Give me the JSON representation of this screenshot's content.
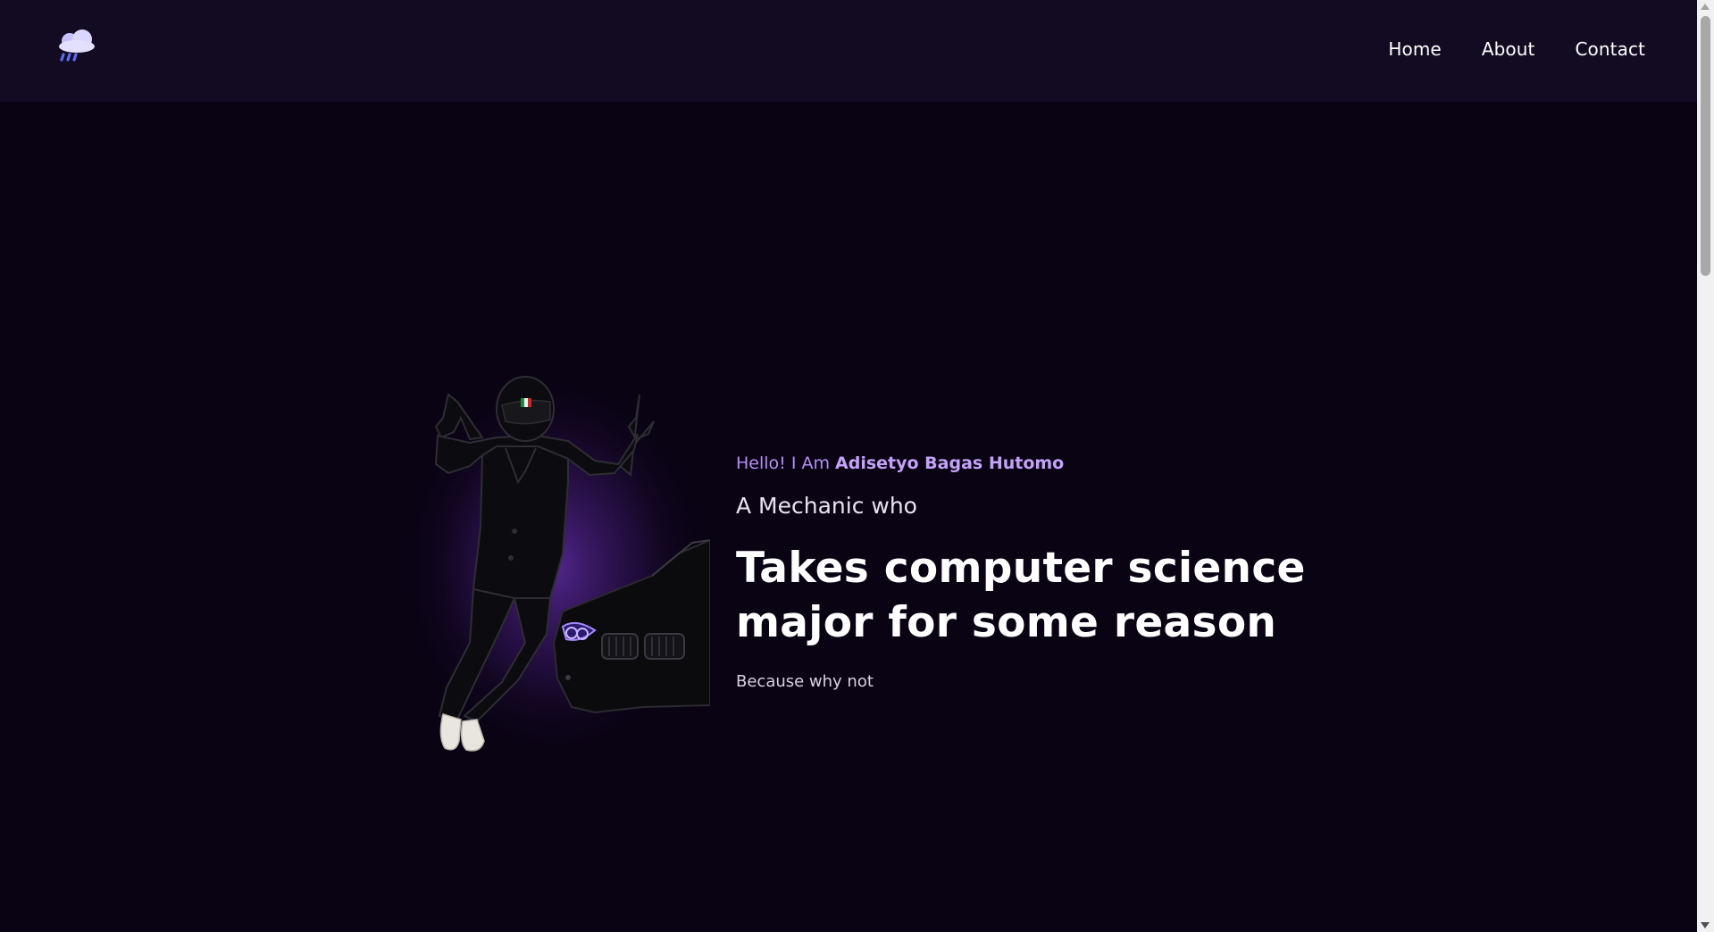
{
  "header": {
    "logo_icon": "rain-cloud-icon",
    "nav": [
      {
        "label": "Home"
      },
      {
        "label": "About"
      },
      {
        "label": "Contact"
      }
    ]
  },
  "hero": {
    "greeting_prefix": "Hello! I Am ",
    "name": "Adisetyo Bagas Hutomo",
    "tagline": "A Mechanic who",
    "headline": "Takes computer science major for some reason",
    "subtext": "Because why not",
    "illustration": "helmeted-figure-with-car-illustration"
  },
  "colors": {
    "background": "#0a0314",
    "navbar": "#120b22",
    "accent": "#b78ef5",
    "accent_strong": "#c4a2f9",
    "glow": "#5b2a9c"
  }
}
